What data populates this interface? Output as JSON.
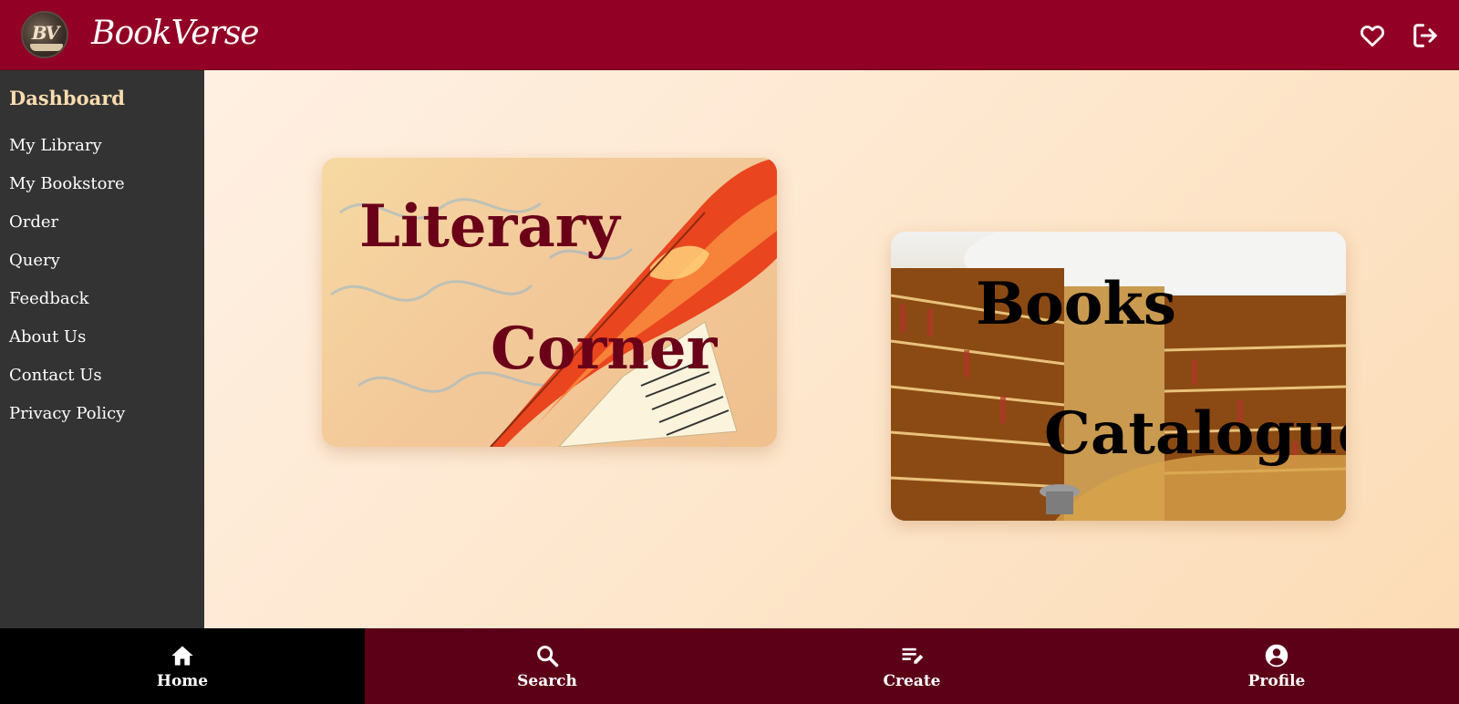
{
  "header": {
    "brand": "BookVerse",
    "logo_monogram": "BV",
    "icons": [
      "heart-icon",
      "logout-icon"
    ],
    "background": "#920025"
  },
  "sidebar": {
    "title": "Dashboard",
    "items": [
      {
        "label": "My Library"
      },
      {
        "label": "My Bookstore"
      },
      {
        "label": "Order"
      },
      {
        "label": "Query"
      },
      {
        "label": "Feedback"
      },
      {
        "label": "About Us"
      },
      {
        "label": "Contact Us"
      },
      {
        "label": "Privacy Policy"
      }
    ]
  },
  "main": {
    "cards": [
      {
        "line1": "Literary",
        "line2": "Corner",
        "text_color": "#6b0019",
        "image": "quill-pen-illustration"
      },
      {
        "line1": "Books",
        "line2": "Catalogue",
        "text_color": "#000000",
        "image": "library-interior-photo"
      }
    ]
  },
  "bottom_nav": {
    "items": [
      {
        "label": "Home",
        "icon": "home-icon",
        "active": true
      },
      {
        "label": "Search",
        "icon": "search-icon",
        "active": false
      },
      {
        "label": "Create",
        "icon": "create-icon",
        "active": false
      },
      {
        "label": "Profile",
        "icon": "profile-icon",
        "active": false
      }
    ]
  }
}
